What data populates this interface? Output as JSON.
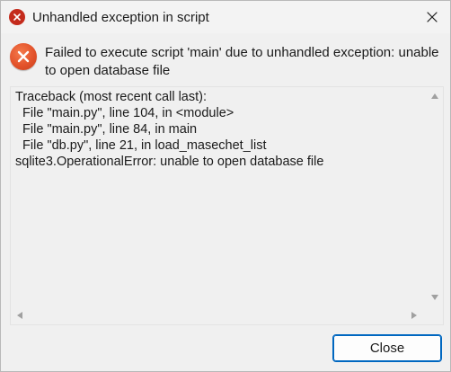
{
  "window": {
    "title": "Unhandled exception in script"
  },
  "message": {
    "text": "Failed to execute script 'main' due to unhandled exception: unable to open database file"
  },
  "traceback": {
    "text": "Traceback (most recent call last):\n  File \"main.py\", line 104, in <module>\n  File \"main.py\", line 84, in main\n  File \"db.py\", line 21, in load_masechet_list\nsqlite3.OperationalError: unable to open database file"
  },
  "buttons": {
    "close_label": "Close"
  },
  "icons": {
    "title": "error-icon",
    "message": "error-icon",
    "window_close": "close-icon"
  },
  "colors": {
    "error_red": "#c42b1c",
    "error_orange": "#e3532b",
    "accent_blue": "#0067c0"
  }
}
